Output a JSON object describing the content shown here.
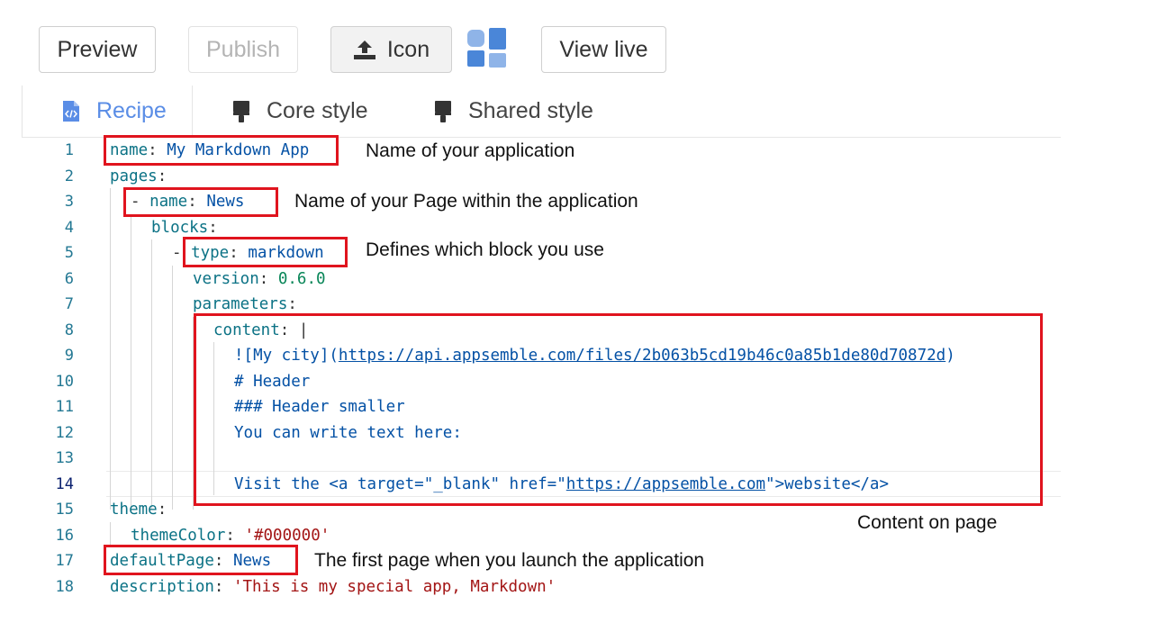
{
  "toolbar": {
    "preview_label": "Preview",
    "publish_label": "Publish",
    "icon_label": "Icon",
    "view_live_label": "View live"
  },
  "tabs": {
    "recipe": "Recipe",
    "core_style": "Core style",
    "shared_style": "Shared style"
  },
  "colors": {
    "accent": "#5a8de6",
    "annotation_box": "#e0141e",
    "yaml_key": "#0b7285",
    "yaml_value": "#0451a5",
    "line_number": "#237893",
    "string": "#a31515",
    "number": "#098658"
  },
  "icons": [
    "upload-icon",
    "app-logo-icon",
    "file-code-icon",
    "paint-brush-icon"
  ],
  "code": {
    "line_numbers": [
      "1",
      "2",
      "3",
      "4",
      "5",
      "6",
      "7",
      "8",
      "9",
      "10",
      "11",
      "12",
      "13",
      "14",
      "15",
      "16",
      "17",
      "18"
    ],
    "l1": {
      "key": "name",
      "colon": ": ",
      "value": "My Markdown App"
    },
    "l2": {
      "key": "pages",
      "colon": ":"
    },
    "l3": {
      "dash": "- ",
      "key": "name",
      "colon": ": ",
      "value": "News"
    },
    "l4": {
      "key": "blocks",
      "colon": ":"
    },
    "l5": {
      "dash": "- ",
      "key": "type",
      "colon": ": ",
      "value": "markdown"
    },
    "l6": {
      "key": "version",
      "colon": ": ",
      "value": "0.6.0"
    },
    "l7": {
      "key": "parameters",
      "colon": ":"
    },
    "l8": {
      "key": "content",
      "colon": ": ",
      "value": "|"
    },
    "l9": {
      "pre": "![My city](",
      "url": "https://api.appsemble.com/files/2b063b5cd19b46c0a85b1de80d70872d",
      "post": ")"
    },
    "l10": {
      "text": "# Header"
    },
    "l11": {
      "text": "### Header smaller"
    },
    "l12": {
      "text": "You can write text here:"
    },
    "l13": {
      "text": ""
    },
    "l14": {
      "pre": "Visit the <a target=\"_blank\" href=\"",
      "url": "https://appsemble.com",
      "post": "\">website</a>"
    },
    "l15": {
      "key": "theme",
      "colon": ":"
    },
    "l16": {
      "key": "themeColor",
      "colon": ": ",
      "value": "'#000000'"
    },
    "l17": {
      "key": "defaultPage",
      "colon": ": ",
      "value": "News"
    },
    "l18": {
      "key": "description",
      "colon": ": ",
      "value": "'This is my special app, Markdown'"
    }
  },
  "annotations": {
    "name": "Name of your application",
    "page_name": "Name of your Page within the application",
    "block_type": "Defines which block you use",
    "content": "Content on page",
    "default_page": "The first page when you launch the application"
  }
}
